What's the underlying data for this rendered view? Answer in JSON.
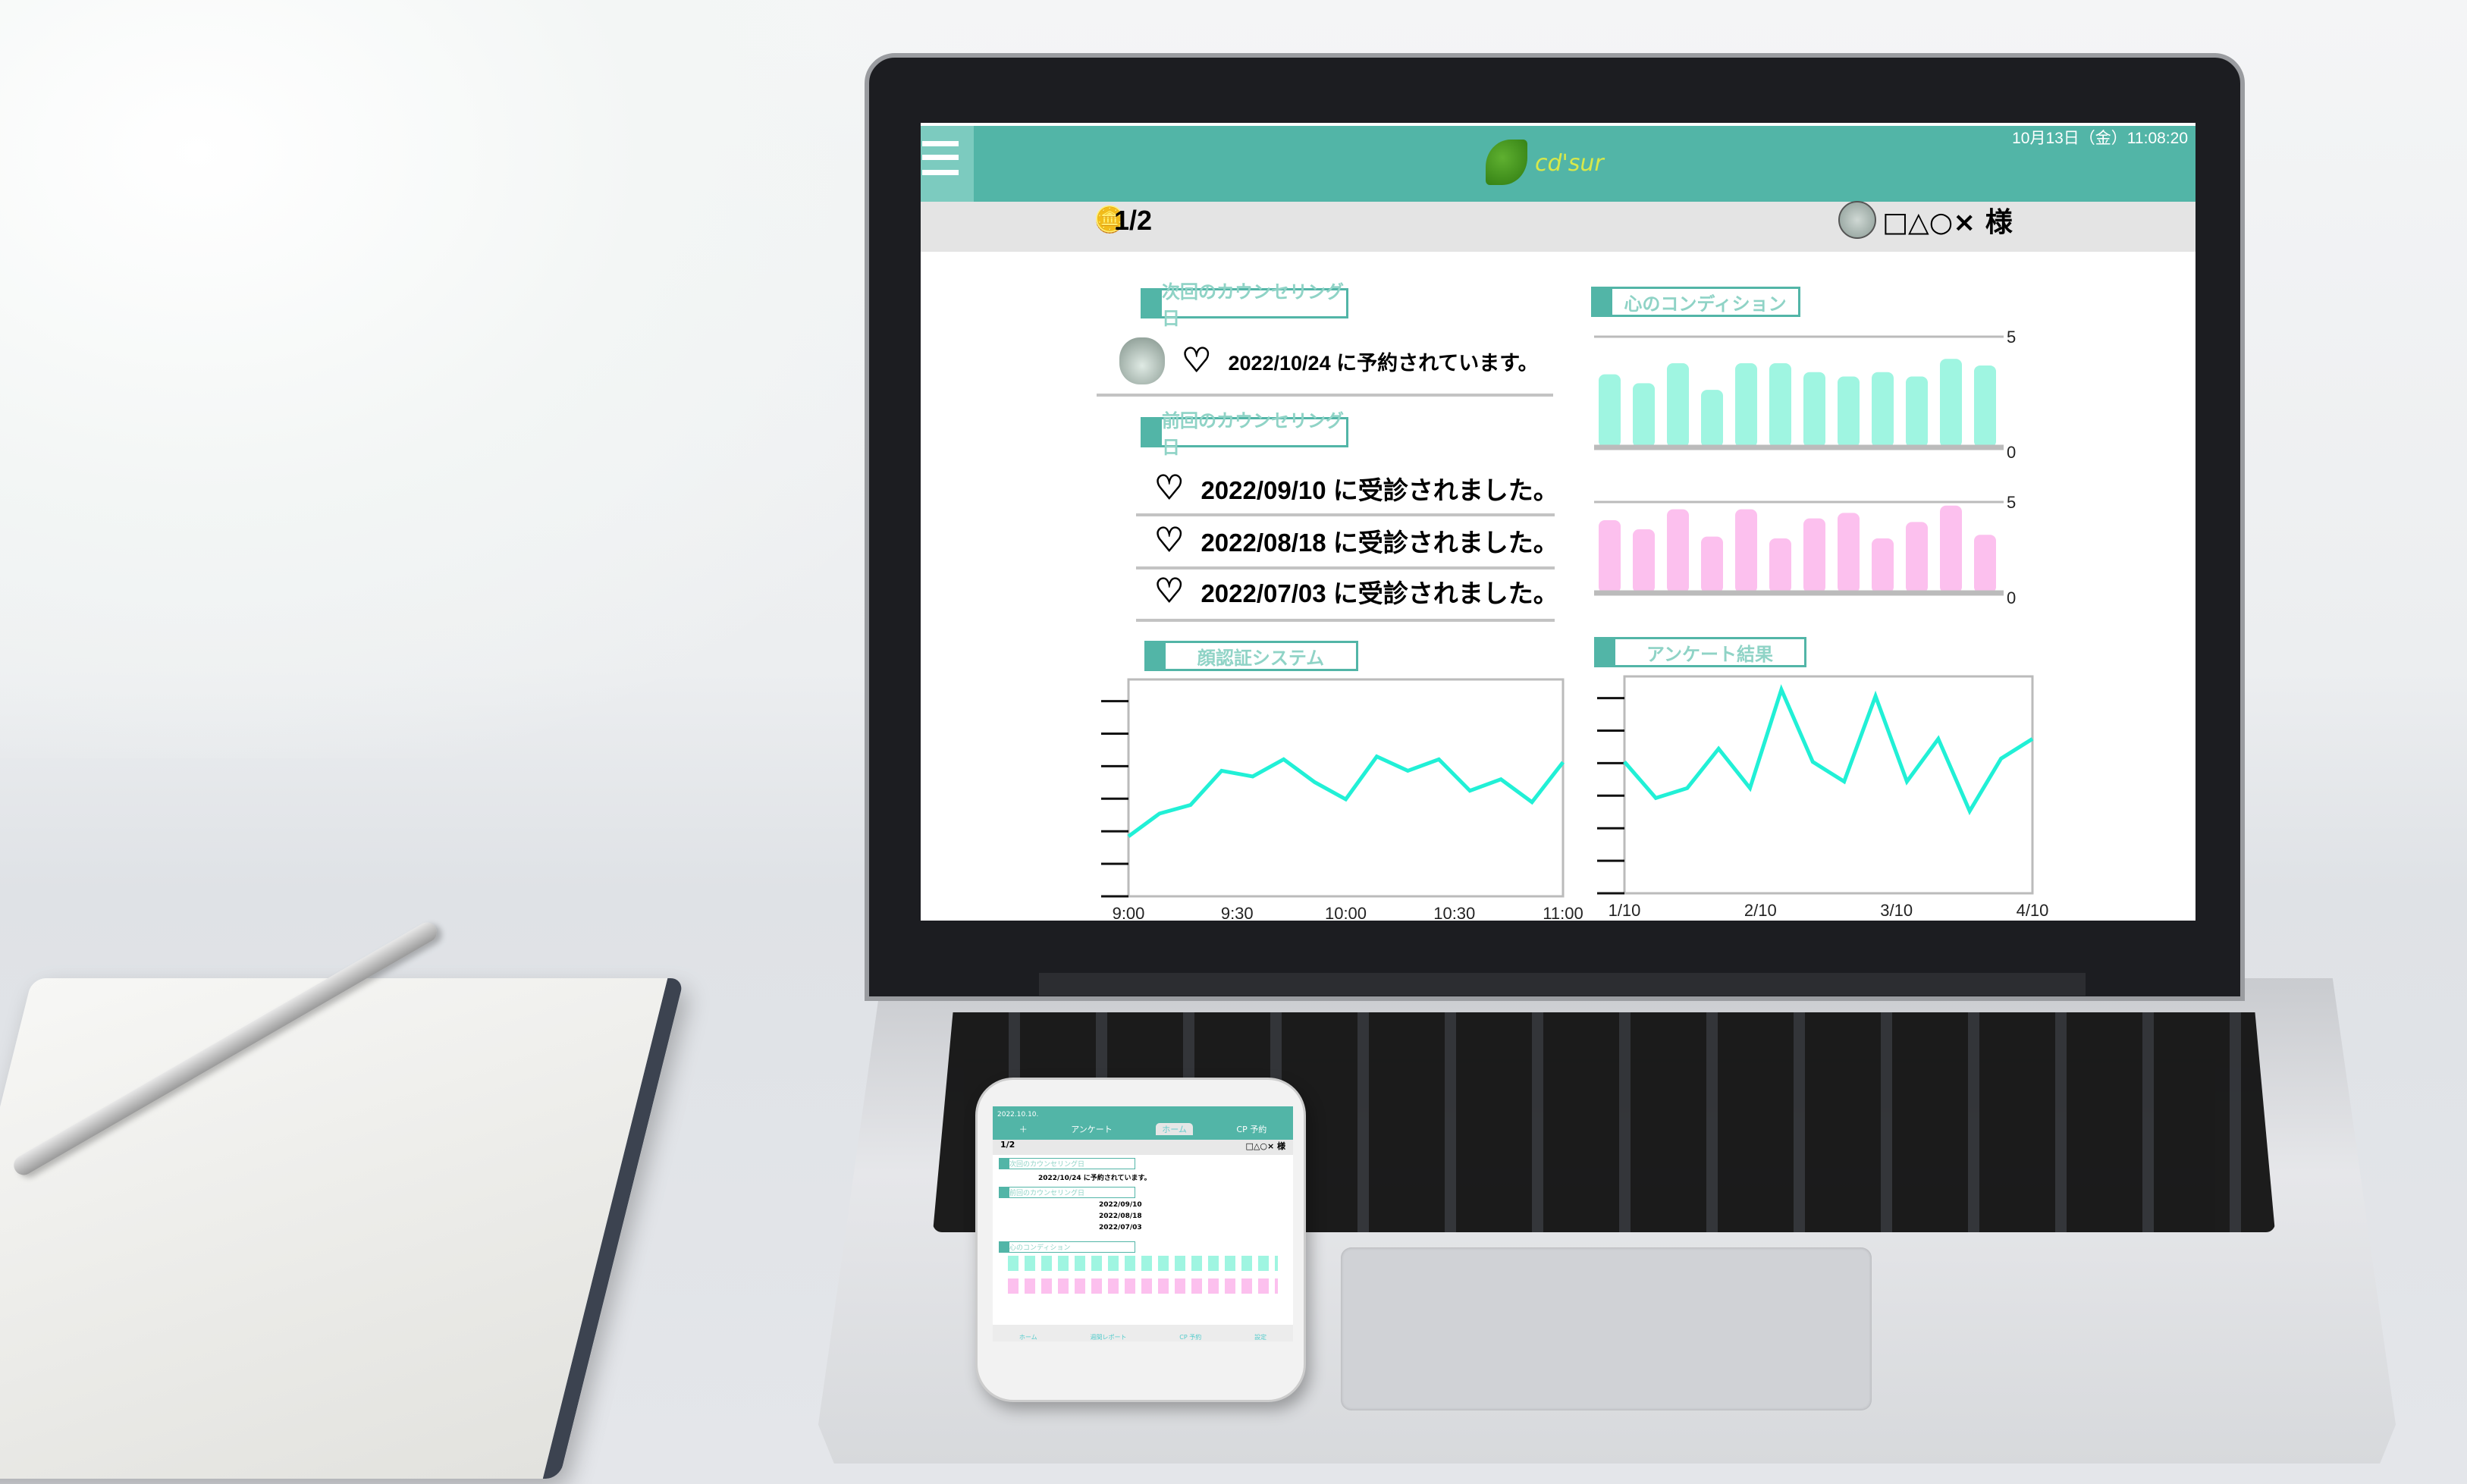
{
  "header": {
    "logo_text": "cd'sur",
    "status": "10月13日（金）11:08:20"
  },
  "subbar": {
    "count": "1/2",
    "user": "□△○× 様"
  },
  "next_counseling": {
    "title": "次回のカウンセリング日",
    "text": "2022/10/24 に予約されています。"
  },
  "previous_counseling": {
    "title": "前回のカウンセリング日",
    "items": [
      "2022/09/10 に受診されました。",
      "2022/08/18 に受診されました。",
      "2022/07/03 に受診されました。"
    ]
  },
  "condition": {
    "title": "心のコンディション"
  },
  "face_system": {
    "title": "顔認証システム"
  },
  "survey": {
    "title": "アンケート結果"
  },
  "colors": {
    "accent": "#52b5a7",
    "bar_teal": "#9ff5e1",
    "bar_pink": "#fcc0ee",
    "line": "#21f0d6"
  },
  "chart_data": [
    {
      "type": "bar",
      "title": "心のコンディション",
      "ylim": [
        0,
        5
      ],
      "yticks": [
        "5",
        "0"
      ],
      "values": [
        3.3,
        2.9,
        3.8,
        2.6,
        3.8,
        3.8,
        3.4,
        3.2,
        3.4,
        3.2,
        4.0,
        3.7
      ]
    },
    {
      "type": "bar",
      "title": "心のコンディション",
      "ylim": [
        0,
        5
      ],
      "yticks": [
        "5",
        "0"
      ],
      "values": [
        4.0,
        3.5,
        4.6,
        3.1,
        4.6,
        3.0,
        4.1,
        4.4,
        3.0,
        3.9,
        4.8,
        3.2
      ]
    },
    {
      "type": "line",
      "title": "顔認証システム",
      "xticks": [
        "9:00",
        "9:30",
        "10:00",
        "10:30",
        "11:00"
      ],
      "ylim": [
        0,
        7.6
      ],
      "values": [
        2.1,
        2.9,
        3.2,
        4.4,
        4.2,
        4.8,
        4.0,
        3.4,
        4.9,
        4.4,
        4.8,
        3.7,
        4.1,
        3.3,
        4.7
      ]
    },
    {
      "type": "line",
      "title": "アンケート結果",
      "xticks": [
        "1/10",
        "2/10",
        "3/10",
        "4/10"
      ],
      "ylim": [
        0,
        6.6
      ],
      "values": [
        4.0,
        2.9,
        3.2,
        4.4,
        3.2,
        6.2,
        4.0,
        3.4,
        6.0,
        3.4,
        4.7,
        2.5,
        4.1,
        4.7
      ]
    }
  ],
  "phone": {
    "date": "2022.10.10.",
    "tabs": [
      "＋",
      "アンケート",
      "ホーム",
      "CP 予約"
    ],
    "count": "1/2",
    "user": "□△○× 様",
    "next_title": "次回のカウンセリング日",
    "next_text": "2022/10/24 に予約されています。",
    "prev_title": "前回のカウンセリング日",
    "prev_items": [
      "2022/09/10",
      "2022/08/18",
      "2022/07/03"
    ],
    "condition_title": "心のコンディション",
    "nav": [
      "ホーム",
      "週間レポート",
      "CP 予約",
      "設定"
    ]
  }
}
